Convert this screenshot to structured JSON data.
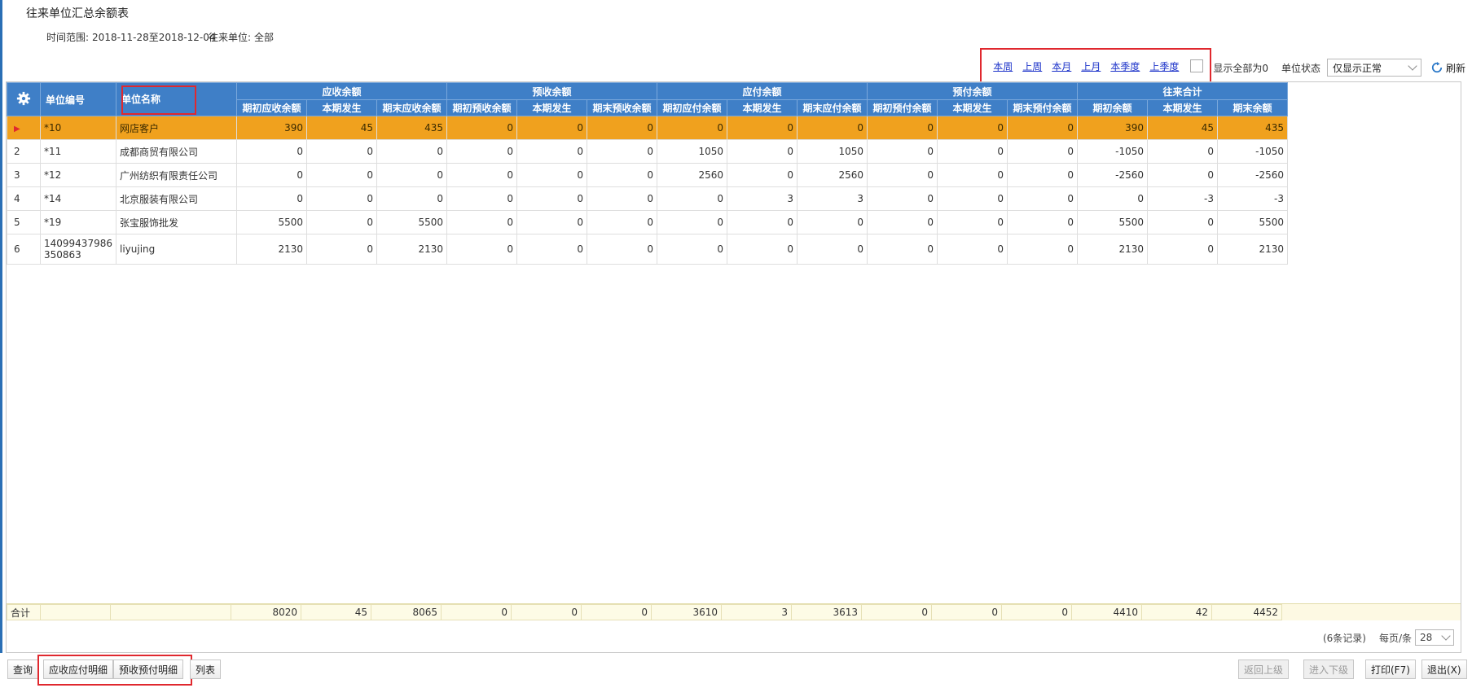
{
  "page": {
    "title": "往来单位汇总余额表",
    "time_range_label": "时间范围:",
    "time_range_value": "2018-11-28至2018-12-04",
    "unit_label": "往来单位:",
    "unit_value": "全部"
  },
  "toolbar": {
    "period_links": [
      "本周",
      "上周",
      "本月",
      "上月",
      "本季度",
      "上季度"
    ],
    "show_zero_label": "显示全部为0",
    "status_label": "单位状态",
    "status_value": "仅显示正常",
    "refresh_label": "刷新"
  },
  "grid": {
    "headers": {
      "code": "单位编号",
      "name": "单位名称",
      "groups": [
        "应收余额",
        "预收余额",
        "应付余额",
        "预付余额",
        "往来合计"
      ],
      "sub": [
        "期初应收余额",
        "本期发生",
        "期末应收余额",
        "期初预收余额",
        "本期发生",
        "期末预收余额",
        "期初应付余额",
        "本期发生",
        "期末应付余额",
        "期初预付余额",
        "本期发生",
        "期末预付余额",
        "期初余额",
        "本期发生",
        "期末余额"
      ]
    },
    "rows": [
      {
        "idx": "",
        "code": "*10",
        "name": "网店客户",
        "values": [
          "390",
          "45",
          "435",
          "0",
          "0",
          "0",
          "0",
          "0",
          "0",
          "0",
          "0",
          "0",
          "390",
          "45",
          "435"
        ]
      },
      {
        "idx": "2",
        "code": "*11",
        "name": "成都商贸有限公司",
        "values": [
          "0",
          "0",
          "0",
          "0",
          "0",
          "0",
          "1050",
          "0",
          "1050",
          "0",
          "0",
          "0",
          "-1050",
          "0",
          "-1050"
        ]
      },
      {
        "idx": "3",
        "code": "*12",
        "name": "广州纺织有限责任公司",
        "values": [
          "0",
          "0",
          "0",
          "0",
          "0",
          "0",
          "2560",
          "0",
          "2560",
          "0",
          "0",
          "0",
          "-2560",
          "0",
          "-2560"
        ]
      },
      {
        "idx": "4",
        "code": "*14",
        "name": "北京服装有限公司",
        "values": [
          "0",
          "0",
          "0",
          "0",
          "0",
          "0",
          "0",
          "3",
          "3",
          "0",
          "0",
          "0",
          "0",
          "-3",
          "-3"
        ]
      },
      {
        "idx": "5",
        "code": "*19",
        "name": "张宝服饰批发",
        "values": [
          "5500",
          "0",
          "5500",
          "0",
          "0",
          "0",
          "0",
          "0",
          "0",
          "0",
          "0",
          "0",
          "5500",
          "0",
          "5500"
        ]
      },
      {
        "idx": "6",
        "code_line1": "14099437986",
        "code_line2": "350863",
        "name": "liyujing",
        "values": [
          "2130",
          "0",
          "2130",
          "0",
          "0",
          "0",
          "0",
          "0",
          "0",
          "0",
          "0",
          "0",
          "2130",
          "0",
          "2130"
        ]
      }
    ],
    "totals": {
      "label": "合计",
      "values": [
        "8020",
        "45",
        "8065",
        "0",
        "0",
        "0",
        "3610",
        "3",
        "3613",
        "0",
        "0",
        "0",
        "4410",
        "42",
        "4452"
      ]
    }
  },
  "pager": {
    "record_count": "(6条记录)",
    "per_page_label": "每页/条",
    "per_page_value": "28"
  },
  "buttons": {
    "query": "查询",
    "ar_ap_detail": "应收应付明细",
    "prepay_detail": "预收预付明细",
    "list": "列表",
    "back_up": "返回上级",
    "enter_down": "进入下级",
    "print": "打印(F7)",
    "exit": "退出(X)"
  },
  "colors": {
    "header_blue": "#3f7fc7",
    "selected_row": "#f0a11e",
    "highlight_red": "#e0282e",
    "link_blue": "#1c33c9"
  }
}
